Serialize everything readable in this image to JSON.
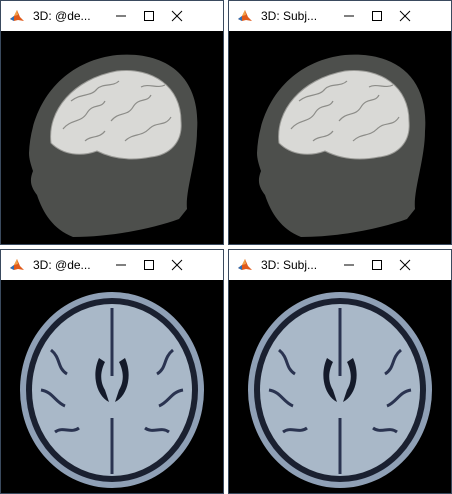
{
  "windows": [
    {
      "title": "3D: @de...",
      "app_icon": "matlab-icon",
      "view": "head-surface-3d"
    },
    {
      "title": "3D: Subj...",
      "app_icon": "matlab-icon",
      "view": "head-surface-3d"
    },
    {
      "title": "3D: @de...",
      "app_icon": "matlab-icon",
      "view": "axial-mri-slice"
    },
    {
      "title": "3D: Subj...",
      "app_icon": "matlab-icon",
      "view": "axial-mri-slice"
    }
  ],
  "controls": {
    "minimize_icon": "minimize-icon",
    "maximize_icon": "maximize-icon",
    "close_icon": "close-icon"
  },
  "colors": {
    "titlebar_bg": "#ffffff",
    "viewport_bg": "#000000",
    "head_surface": "#4d4f4c",
    "brain_surface": "#d9d9d6",
    "mri_tissue": "#a9b8c8"
  }
}
